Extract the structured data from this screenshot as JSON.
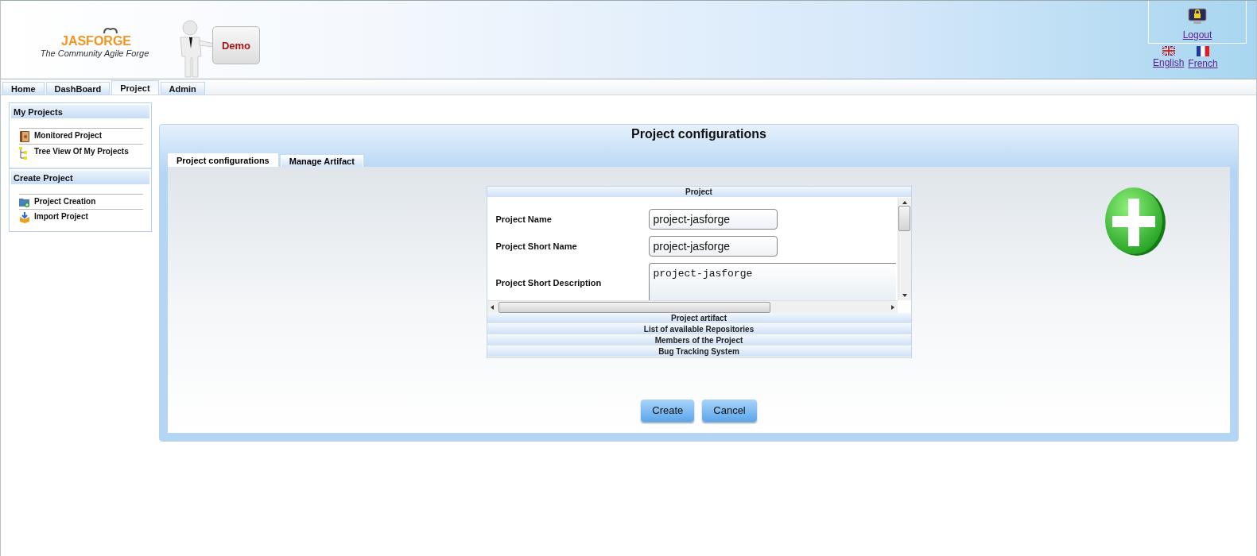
{
  "header": {
    "logo": {
      "name": "JASFORGE",
      "tagline": "The Community Agile Forge"
    },
    "demo_label": "Demo",
    "logout": "Logout",
    "languages": [
      {
        "label": "English",
        "kind": "uk"
      },
      {
        "label": "French",
        "kind": "fr"
      }
    ]
  },
  "tabs": [
    {
      "label": "Home",
      "selected": false
    },
    {
      "label": "DashBoard",
      "selected": false
    },
    {
      "label": "Project",
      "selected": true
    },
    {
      "label": "Admin",
      "selected": false
    }
  ],
  "sidebar": {
    "sections": [
      {
        "title": "My Projects",
        "items": [
          {
            "label": "Monitored Project",
            "kind": "book"
          },
          {
            "label": "Tree View Of My Projects",
            "kind": "tree"
          }
        ]
      },
      {
        "title": "Create Project",
        "items": [
          {
            "label": "Project Creation",
            "kind": "folder"
          },
          {
            "label": "Import Project",
            "kind": "import"
          }
        ]
      }
    ]
  },
  "panel": {
    "title": "Project configurations",
    "tabs": [
      {
        "label": "Project configurations",
        "selected": true
      },
      {
        "label": "Manage Artifact",
        "selected": false
      }
    ],
    "form": {
      "section": "Project",
      "fields": [
        {
          "label": "Project Name",
          "value": "project-jasforge",
          "kind": "input"
        },
        {
          "label": "Project Short Name",
          "value": "project-jasforge",
          "kind": "input"
        },
        {
          "label": "Project Short Description",
          "value": "project-jasforge",
          "kind": "textarea"
        }
      ]
    },
    "sections": [
      "Project artifact",
      "List of available Repositories",
      "Members of the Project",
      "Bug Tracking System"
    ],
    "buttons": [
      "Create",
      "Cancel"
    ]
  }
}
